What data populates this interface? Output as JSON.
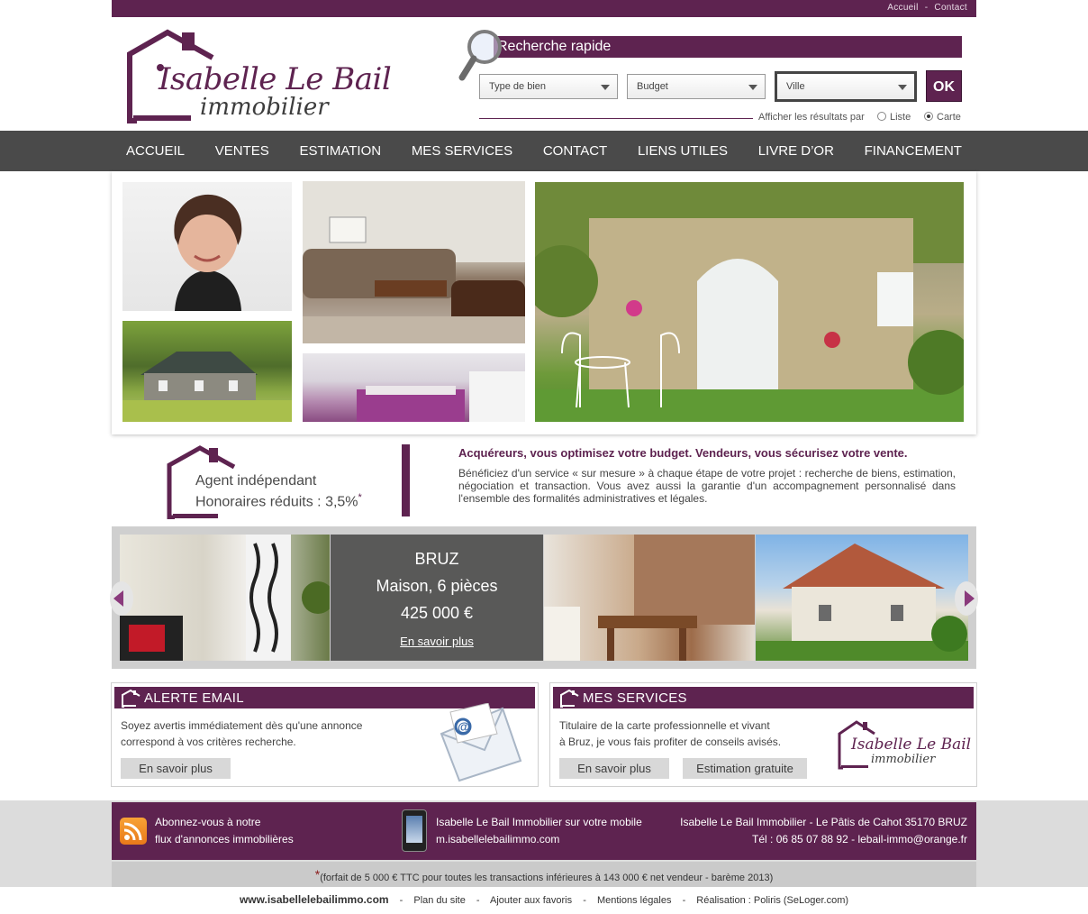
{
  "top_links": {
    "accueil": "Accueil",
    "separator": "-",
    "contact": "Contact"
  },
  "logo": {
    "line1": "Isabelle Le Bail",
    "line2": "immobilier"
  },
  "search": {
    "title": "Recherche rapide",
    "type_placeholder": "Type de bien",
    "budget_placeholder": "Budget",
    "ville_placeholder": "Ville",
    "ok_label": "OK",
    "results_label": "Afficher les résultats par",
    "option_liste": "Liste",
    "option_carte": "Carte",
    "selected_option": "Carte"
  },
  "nav": [
    "ACCUEIL",
    "VENTES",
    "ESTIMATION",
    "MES SERVICES",
    "CONTACT",
    "LIENS UTILES",
    "LIVRE D’OR",
    "FINANCEMENT"
  ],
  "agent": {
    "line1": "Agent indépendant",
    "line2": "Honoraires réduits : 3,5%",
    "star": "*"
  },
  "intro": {
    "title": "Acquéreurs, vous optimisez votre budget.  Vendeurs,  vous sécurisez  votre vente.",
    "text": "Bénéficiez d'un service « sur mesure » à chaque étape de votre projet : recherche de biens, estimation, négociation et transaction. Vous avez aussi la garantie d'un accompagnement personnalisé dans l'ensemble des formalités administratives et légales."
  },
  "carousel": {
    "city": "BRUZ",
    "type": "Maison, 6 pièces",
    "price": "425 000 €",
    "link": "En savoir plus"
  },
  "alert_box": {
    "title": "ALERTE EMAIL",
    "text_line1": "Soyez avertis immédiatement dès qu'une annonce",
    "text_line2": "correspond à vos critères recherche.",
    "button": "En savoir plus"
  },
  "services_box": {
    "title": "MES SERVICES",
    "text_line1": "Titulaire de la carte professionnelle et vivant",
    "text_line2": "à Bruz, je vous fais profiter de conseils avisés.",
    "button1": "En savoir plus",
    "button2": "Estimation gratuite"
  },
  "footer": {
    "rss_line1": "Abonnez-vous à notre",
    "rss_line2": "flux d'annonces immobilières",
    "mobile_line1": "Isabelle Le Bail Immobilier sur votre mobile",
    "mobile_line2": "m.isabellelebailimmo.com",
    "address_line1": "Isabelle Le Bail Immobilier - Le Pâtis de Cahot 35170 BRUZ",
    "address_line2": "Tél : 06 85 07 88 92 - lebail-immo@orange.fr",
    "note_star": "*",
    "note": "(forfait de  5 000 € TTC pour toutes les transactions inférieures à 143 000 € net vendeur - barème 2013)",
    "site": "www.isabellelebailimmo.com",
    "link_sep": "-",
    "plan": "Plan du site",
    "favoris": "Ajouter aux favoris",
    "mentions": "Mentions légales",
    "realisation": "Réalisation : Poliris (SeLoger.com)"
  },
  "colors": {
    "brand": "#5e2350",
    "nav_bg": "#4a4a4a",
    "accent_arrow": "#8a3a7c"
  },
  "icons": [
    "house-logo-icon",
    "magnifier-icon",
    "chevron-down-icon",
    "envelope-icon",
    "rss-icon",
    "phone-icon",
    "arrow-left-icon",
    "arrow-right-icon"
  ]
}
